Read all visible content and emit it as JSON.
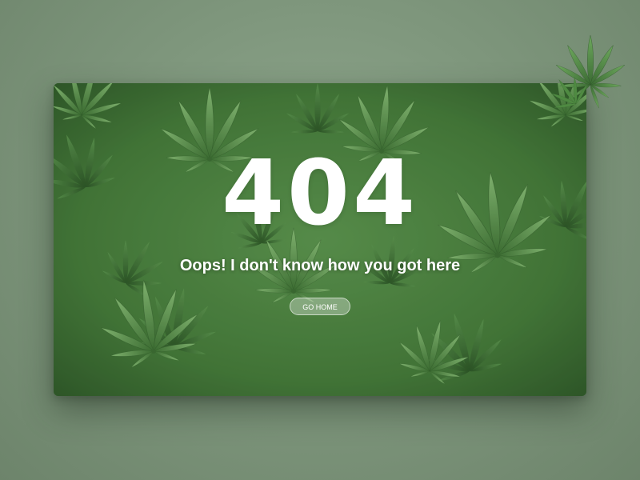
{
  "error_page": {
    "code": "404",
    "message": "Oops! I don't know how you got here",
    "home_button_label": "GO HOME"
  },
  "colors": {
    "page_background": "#7f977d",
    "leaf_dark": "#2f5a2a",
    "leaf_mid": "#4f8a42",
    "leaf_light": "#7db36c",
    "text": "#ffffff"
  }
}
